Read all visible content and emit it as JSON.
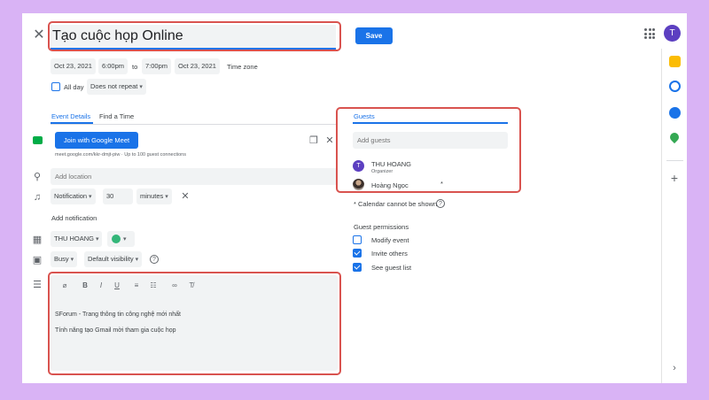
{
  "header": {
    "title_value": "Tạo cuộc họp Online",
    "save_label": "Save",
    "avatar_initial": "T"
  },
  "datetime": {
    "start_date": "Oct 23, 2021",
    "start_time": "6:00pm",
    "to_label": "to",
    "end_time": "7:00pm",
    "end_date": "Oct 23, 2021",
    "timezone_label": "Time zone",
    "all_day_label": "All day",
    "repeat_value": "Does not repeat"
  },
  "tabs": [
    {
      "label": "Event Details",
      "active": true
    },
    {
      "label": "Find a Time",
      "active": false
    }
  ],
  "meet": {
    "button_label": "Join with Google Meet",
    "info": "meet.google.com/kkr-dmjt-piw · Up to 100 guest connections"
  },
  "location": {
    "placeholder": "Add location"
  },
  "notification": {
    "type": "Notification",
    "amount": "30",
    "unit": "minutes",
    "add_label": "Add notification"
  },
  "calendar": {
    "owner": "THU HOANG",
    "color": "#33b679"
  },
  "availability": {
    "busy": "Busy",
    "visibility": "Default visibility"
  },
  "description": {
    "lines": [
      "SForum - Trang thông tin công nghệ mới nhất",
      "Tính năng tạo Gmail mời tham gia cuộc họp"
    ]
  },
  "guests": {
    "tab_label": "Guests",
    "add_placeholder": "Add guests",
    "list": [
      {
        "name": "THU HOANG",
        "role": "Organizer",
        "initial": "T"
      },
      {
        "name": "Hoàng Ngọc",
        "marker": "*"
      }
    ],
    "calendar_note": "* Calendar cannot be shown",
    "permissions_title": "Guest permissions",
    "permissions": [
      {
        "label": "Modify event",
        "checked": false
      },
      {
        "label": "Invite others",
        "checked": true
      },
      {
        "label": "See guest list",
        "checked": true
      }
    ]
  },
  "colors": {
    "accent": "#1a73e8",
    "avatar": "#5c3fc1",
    "highlight": "#d9534f",
    "backdrop": "#d9b3f5"
  }
}
